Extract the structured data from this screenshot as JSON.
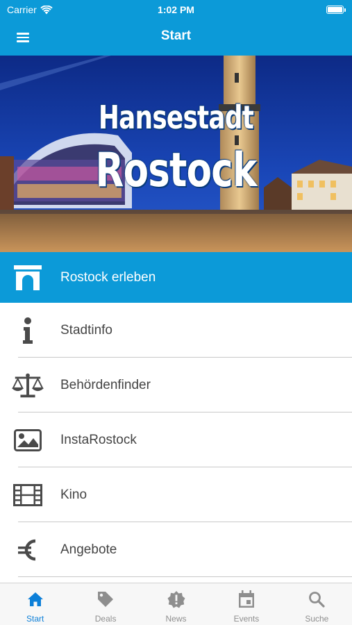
{
  "status_bar": {
    "carrier": "Carrier",
    "time": "1:02 PM"
  },
  "nav": {
    "title": "Start"
  },
  "hero": {
    "line1": "Hansestadt",
    "line2": "Rostock"
  },
  "menu": [
    {
      "label": "Rostock erleben",
      "icon": "gate-icon",
      "active": true
    },
    {
      "label": "Stadtinfo",
      "icon": "info-icon"
    },
    {
      "label": "Behördenfinder",
      "icon": "scales-icon"
    },
    {
      "label": "InstaRostock",
      "icon": "image-icon"
    },
    {
      "label": "Kino",
      "icon": "film-icon"
    },
    {
      "label": "Angebote",
      "icon": "euro-icon"
    }
  ],
  "tabs": [
    {
      "label": "Start",
      "icon": "home-icon",
      "active": true
    },
    {
      "label": "Deals",
      "icon": "tag-icon"
    },
    {
      "label": "News",
      "icon": "alert-icon"
    },
    {
      "label": "Events",
      "icon": "calendar-icon"
    },
    {
      "label": "Suche",
      "icon": "search-icon"
    }
  ],
  "colors": {
    "primary": "#0c9ad8",
    "tab_active": "#0c7fd8",
    "tab_inactive": "#8e8e8e",
    "icon_gray": "#4a4a4a"
  }
}
